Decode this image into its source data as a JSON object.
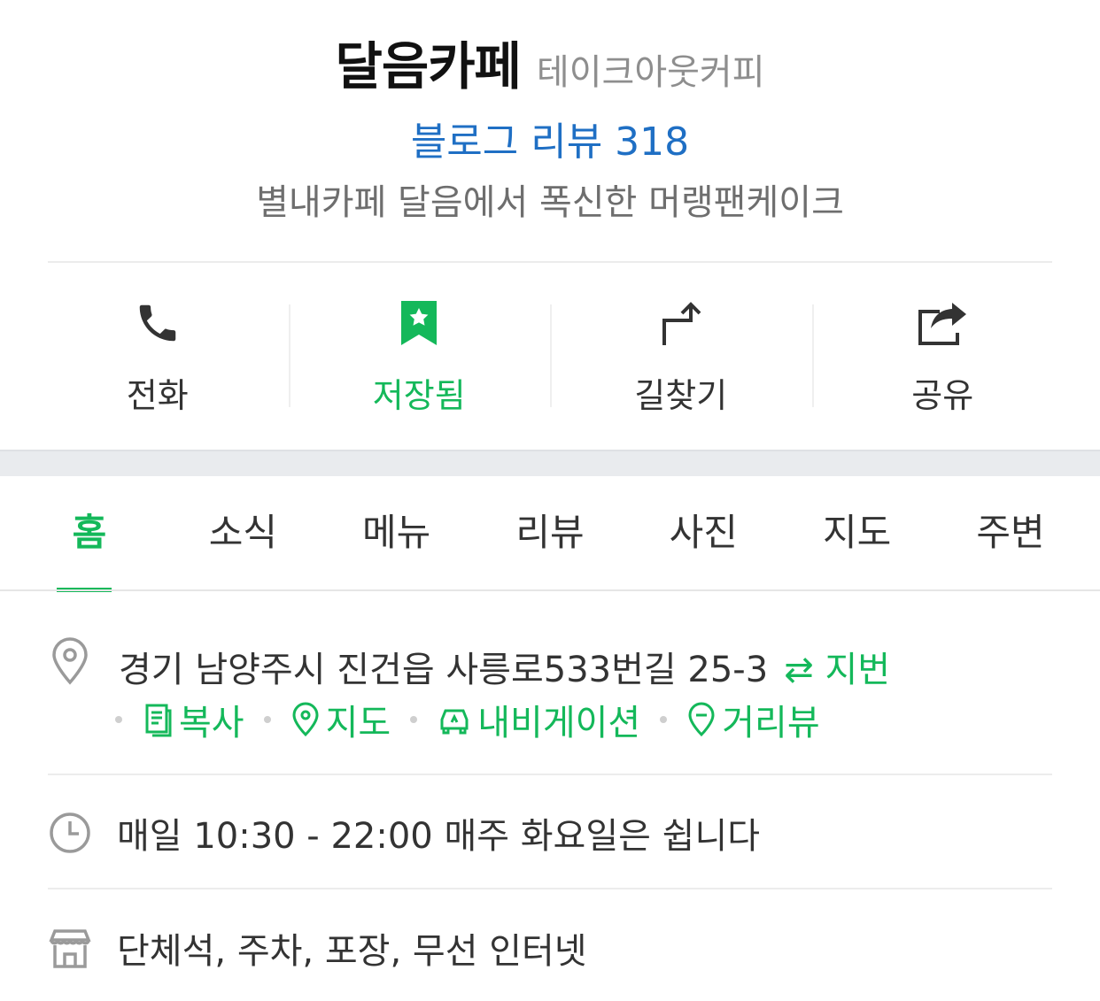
{
  "header": {
    "name": "달음카페",
    "category": "테이크아웃커피",
    "blog_review": "블로그 리뷰 318",
    "tagline": "별내카페 달음에서 폭신한 머랭팬케이크"
  },
  "actions": [
    {
      "label": "전화",
      "icon": "phone-icon"
    },
    {
      "label": "저장됨",
      "icon": "bookmark-star-icon"
    },
    {
      "label": "길찾기",
      "icon": "directions-icon"
    },
    {
      "label": "공유",
      "icon": "share-icon"
    }
  ],
  "tabs": [
    "홈",
    "소식",
    "메뉴",
    "리뷰",
    "사진",
    "지도",
    "주변"
  ],
  "active_tab": "홈",
  "address": {
    "text": "경기 남양주시 진건읍 사릉로533번길 25-3",
    "toggle": "지번",
    "links": [
      "복사",
      "지도",
      "내비게이션",
      "거리뷰"
    ]
  },
  "hours": "매일 10:30 - 22:00 매주 화요일은 쉽니다",
  "amenities": "단체석, 주차, 포장, 무선 인터넷",
  "colors": {
    "accent": "#14b85a",
    "link_blue": "#1f6fc4",
    "muted": "#8e8e8e"
  }
}
